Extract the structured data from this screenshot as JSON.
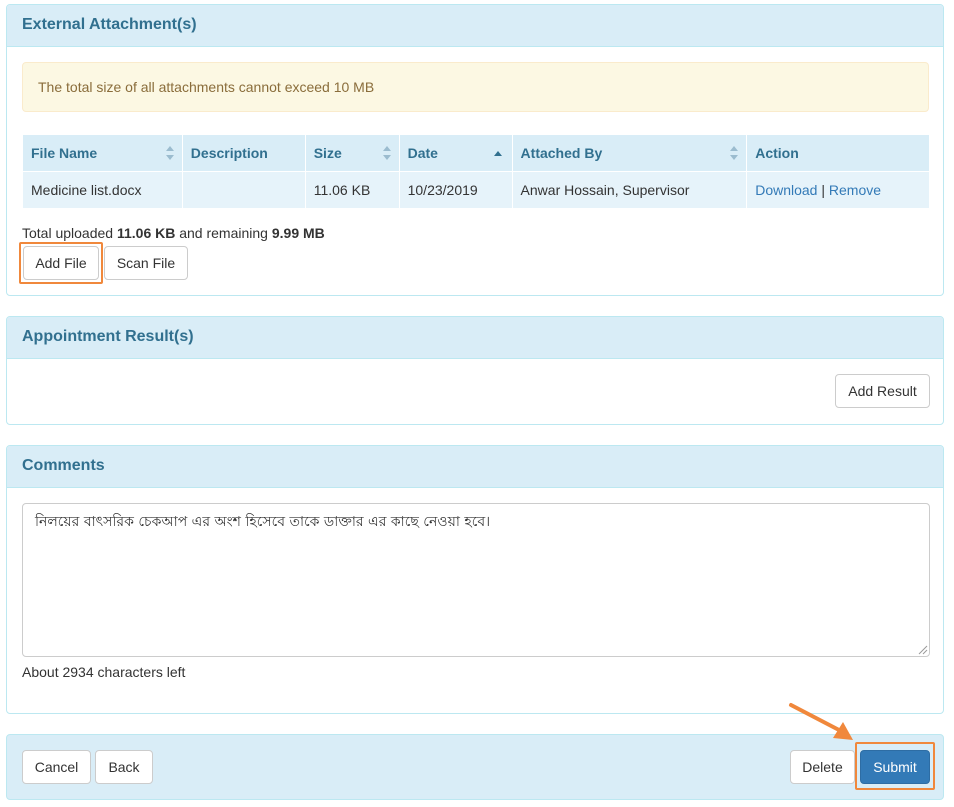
{
  "colors": {
    "panel_heading_bg": "#d9edf7",
    "panel_heading_text": "#31708f",
    "alert_bg": "#fcf8e3",
    "alert_text": "#8a6d3b",
    "link": "#337ab7",
    "primary": "#337ab7",
    "highlight": "#f0883c"
  },
  "attachments": {
    "title": "External Attachment(s)",
    "alert": "The total size of all attachments cannot exceed 10 MB",
    "columns": [
      "File Name",
      "Description",
      "Size",
      "Date",
      "Attached By",
      "Action"
    ],
    "rows": [
      {
        "file_name": "Medicine list.docx",
        "description": "",
        "size": "11.06 KB",
        "date": "10/23/2019",
        "attached_by": "Anwar Hossain, Supervisor",
        "download_label": "Download",
        "separator": "|",
        "remove_label": "Remove"
      }
    ],
    "summary_prefix": "Total uploaded",
    "uploaded": "11.06 KB",
    "summary_middle": "and remaining",
    "remaining": "9.99 MB",
    "add_file_label": "Add File",
    "scan_file_label": "Scan File"
  },
  "results": {
    "title": "Appointment Result(s)",
    "add_result_label": "Add Result"
  },
  "comments": {
    "title": "Comments",
    "value": "নিলয়ের বাৎসরিক চেকআপ এর অংশ হিসেবে তাকে ডাক্তার এর কাছে নেওয়া হবে।",
    "chars_left": "About 2934 characters left"
  },
  "footer": {
    "cancel_label": "Cancel",
    "back_label": "Back",
    "delete_label": "Delete",
    "submit_label": "Submit"
  }
}
